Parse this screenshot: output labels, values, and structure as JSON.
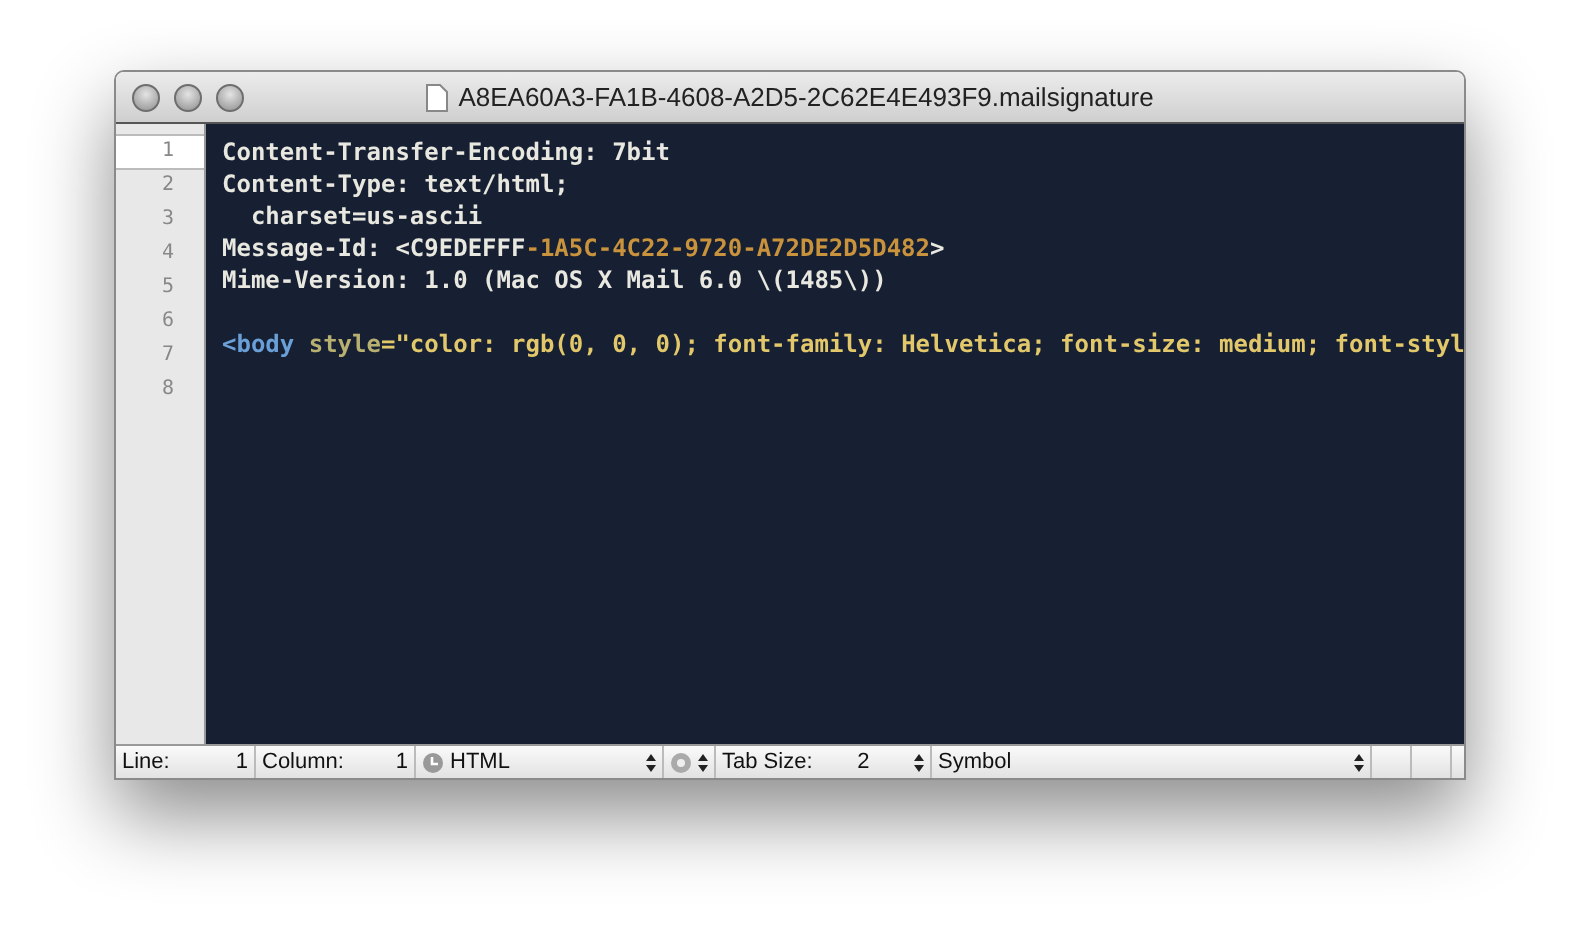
{
  "window": {
    "title": "A8EA60A3-FA1B-4608-A2D5-2C62E4E493F9.mailsignature"
  },
  "lines": [
    {
      "number": "1",
      "current": true,
      "segments": [
        {
          "kind": "plain",
          "text": "Content-Transfer-Encoding: 7bit"
        }
      ]
    },
    {
      "number": "2",
      "current": false,
      "segments": [
        {
          "kind": "plain",
          "text": "Content-Type: text/html;"
        }
      ]
    },
    {
      "number": "3",
      "current": false,
      "segments": [
        {
          "kind": "plain",
          "text": "  charset=us-ascii"
        }
      ]
    },
    {
      "number": "4",
      "current": false,
      "segments": [
        {
          "kind": "plain",
          "text": "Message-Id: <C9EDEFFF"
        },
        {
          "kind": "number",
          "text": "-1A5C-4C22-9720-A72DE2D5D482"
        },
        {
          "kind": "plain",
          "text": ">"
        }
      ]
    },
    {
      "number": "5",
      "current": false,
      "segments": [
        {
          "kind": "plain",
          "text": "Mime-Version: 1.0 (Mac OS X Mail 6.0 \\(1485\\))"
        }
      ]
    },
    {
      "number": "6",
      "current": false
    },
    {
      "number": "7",
      "current": false,
      "segments": [
        {
          "kind": "tag",
          "text": "<body"
        },
        {
          "kind": "attr",
          "text": " style"
        },
        {
          "kind": "string",
          "text": "=\"color: rgb(0, 0, 0); font-family: Helvetica; font-size: medium; font-styl"
        }
      ]
    },
    {
      "number": "8",
      "current": false
    }
  ],
  "status_bar": {
    "line_label": "Line:",
    "line": "1",
    "column_label": "Column:",
    "column": "1",
    "syntax": "HTML",
    "tab_size_label": "Tab Size:",
    "tab_size": "2",
    "symbol": "Symbol"
  }
}
